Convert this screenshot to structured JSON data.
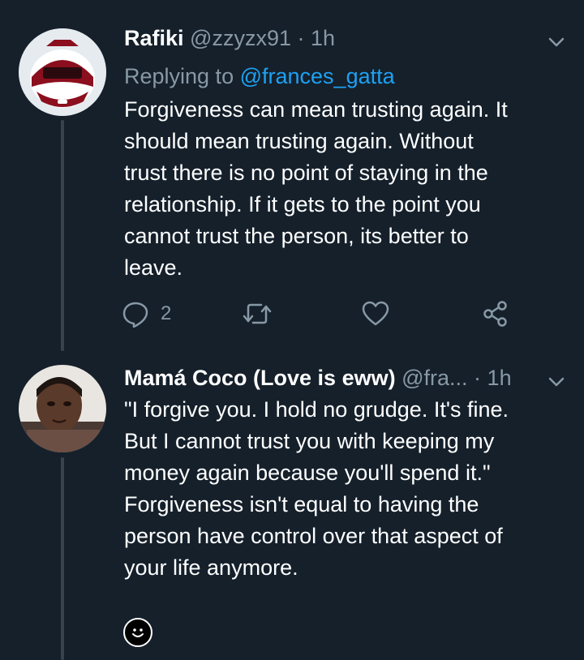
{
  "tweets": [
    {
      "name": "Rafiki",
      "handle": "@zzyzx91",
      "separator": "·",
      "time": "1h",
      "reply_prefix": "Replying to",
      "reply_to": "@frances_gatta",
      "lines": [
        "Forgiveness can mean trusting again. It",
        "should mean trusting again. Without",
        "trust there is no point of staying in the",
        "relationship. If it gets to the point you",
        "cannot trust the person, its better to",
        "leave."
      ],
      "actions": {
        "reply_count": "2",
        "icons": [
          "reply-icon",
          "retweet-icon",
          "like-icon",
          "share-icon"
        ]
      }
    },
    {
      "name": "Mamá Coco (Love is eww)",
      "handle": "@fra...",
      "separator": "·",
      "time": "1h",
      "lines": [
        "\"I forgive you. I hold no grudge. It's fine.",
        "But I cannot trust you with keeping my",
        "money again because you'll spend it.\"",
        "Forgiveness isn't equal to having the",
        "person have control over that aspect of",
        "your life anymore."
      ]
    }
  ],
  "colors": {
    "background": "#15202b",
    "secondary_text": "#8899a6",
    "link": "#1da1f2",
    "thread_line": "#38444d"
  }
}
